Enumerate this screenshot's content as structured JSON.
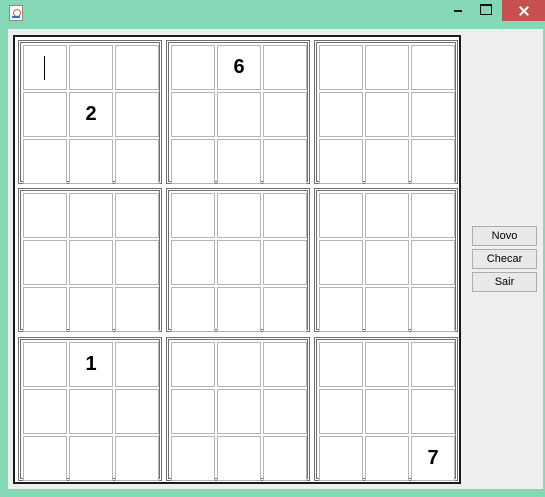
{
  "window": {
    "app_icon": "java-cup-icon",
    "controls": [
      "minimize-icon",
      "maximize-icon",
      "close-icon"
    ]
  },
  "grid": [
    [
      "",
      "",
      "",
      "",
      "6",
      "",
      "",
      "",
      ""
    ],
    [
      "",
      "2",
      "",
      "",
      "",
      "",
      "",
      "",
      ""
    ],
    [
      "",
      "",
      "",
      "",
      "",
      "",
      "",
      "",
      ""
    ],
    [
      "",
      "",
      "",
      "",
      "",
      "",
      "",
      "",
      ""
    ],
    [
      "",
      "",
      "",
      "",
      "",
      "",
      "",
      "",
      ""
    ],
    [
      "",
      "",
      "",
      "",
      "",
      "",
      "",
      "",
      ""
    ],
    [
      "",
      "1",
      "",
      "",
      "",
      "",
      "",
      "",
      ""
    ],
    [
      "",
      "",
      "",
      "",
      "",
      "",
      "",
      "",
      ""
    ],
    [
      "",
      "",
      "",
      "",
      "",
      "",
      "",
      "",
      "7"
    ]
  ],
  "actions": {
    "new_label": "Novo",
    "check_label": "Checar",
    "exit_label": "Sair"
  },
  "colors": {
    "window_frame": "#84d8b6",
    "client_background": "#efefef",
    "close_button": "#c7504e"
  }
}
